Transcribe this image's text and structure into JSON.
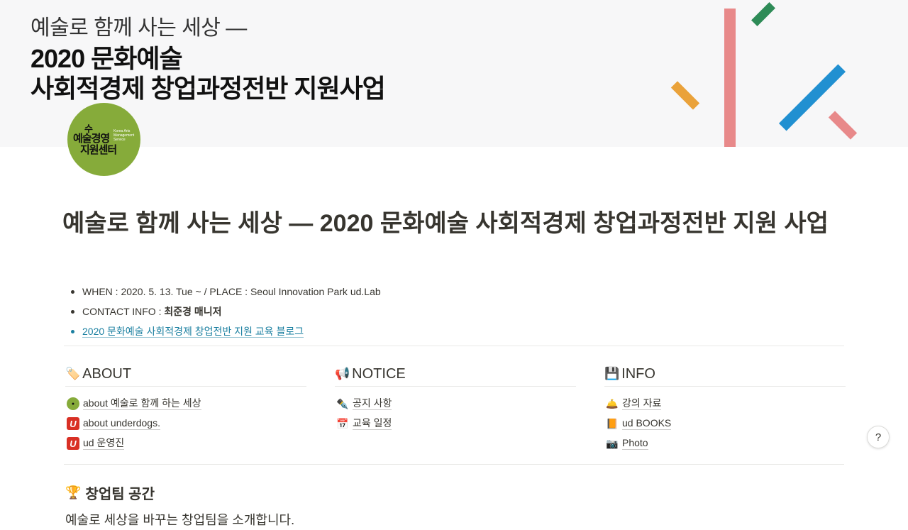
{
  "cover": {
    "subtitle": "예술로 함께 사는 세상 —",
    "title_line1": "2020 문화예술",
    "title_line2": "사회적경제 창업과정전반 지원사업"
  },
  "logo": {
    "ko_line0": "수",
    "ko_line1": "예술경영",
    "ko_line2": "지원센터",
    "en_text": "Korea Arts Management Service"
  },
  "page": {
    "title": "예술로 함께 사는 세상 — 2020 문화예술 사회적경제 창업과정전반 지원 사업"
  },
  "info": {
    "when": "WHEN : 2020. 5. 13. Tue ~ / PLACE : Seoul Innovation Park ud.Lab",
    "contact_label": "CONTACT INFO : ",
    "contact_name": "최준경 매니저",
    "blog_link": "2020 문화예술 사회적경제 창업전반 지원 교육 블로그"
  },
  "columns": {
    "about": {
      "emoji": "🏷️",
      "title": "ABOUT",
      "items": [
        {
          "icon": "logo-icon",
          "label": "about 예술로 함께 하는 세상"
        },
        {
          "icon": "underdogs-icon",
          "glyph": "U",
          "label": "about underdogs."
        },
        {
          "icon": "underdogs-icon",
          "glyph": "U",
          "label": "ud 운영진"
        }
      ]
    },
    "notice": {
      "emoji": "📢",
      "title": "NOTICE",
      "items": [
        {
          "icon": "pen-icon",
          "glyph": "✒️",
          "label": "공지 사항"
        },
        {
          "icon": "calendar-icon",
          "glyph": "📅",
          "label": "교육 일정"
        }
      ]
    },
    "info": {
      "emoji": "💾",
      "title": "INFO",
      "items": [
        {
          "icon": "bell-icon",
          "glyph": "🛎️",
          "label": "강의 자료"
        },
        {
          "icon": "book-icon",
          "glyph": "📙",
          "label": "ud BOOKS"
        },
        {
          "icon": "camera-icon",
          "glyph": "📷",
          "label": "Photo"
        }
      ]
    }
  },
  "team_section": {
    "emoji": "🏆",
    "title": "창업팀 공간",
    "description": "예술로 세상을 바꾸는 창업팀을 소개합니다."
  },
  "help": {
    "label": "?"
  },
  "colors": {
    "text": "#37352f",
    "link": "#1a7fa0",
    "logo_green": "#86ab3a",
    "deco_pink": "#e8898a",
    "deco_blue": "#2190d1",
    "deco_orange": "#eaa23a",
    "deco_green": "#2e8b57"
  }
}
